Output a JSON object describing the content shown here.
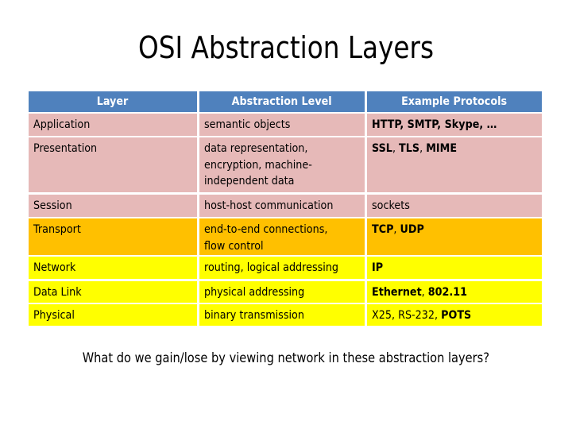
{
  "slide": {
    "title": "OSI Abstraction Layers",
    "question": "What do we gain/lose by viewing network in these abstraction layers?"
  },
  "colors": {
    "header": "#4f81bd",
    "upper_layers": "#e6b9b8",
    "transport": "#ffc000",
    "lower_layers": "#ffff00"
  },
  "table": {
    "headers": [
      "Layer",
      "Abstraction Level",
      "Example Protocols"
    ],
    "rows": [
      {
        "layer": "Application",
        "level_lines": [
          "semantic objects"
        ],
        "protocols": [
          {
            "t": "HTTP, SMTP, Skype, …",
            "b": true
          }
        ],
        "band": "pink"
      },
      {
        "layer": "Presentation",
        "level_lines": [
          "data representation,",
          "encryption, machine-",
          "independent data"
        ],
        "protocols": [
          {
            "t": "SSL",
            "b": true
          },
          {
            "t": ", ",
            "b": false
          },
          {
            "t": "TLS",
            "b": true
          },
          {
            "t": ", ",
            "b": false
          },
          {
            "t": "MIME",
            "b": true
          }
        ],
        "band": "pink"
      },
      {
        "layer": "Session",
        "level_lines": [
          "host-host communication"
        ],
        "protocols": [
          {
            "t": "sockets",
            "b": false
          }
        ],
        "band": "pink"
      },
      {
        "layer": "Transport",
        "level_lines": [
          "end-to-end connections,",
          "flow control"
        ],
        "protocols": [
          {
            "t": "TCP",
            "b": true
          },
          {
            "t": ", ",
            "b": false
          },
          {
            "t": "UDP",
            "b": true
          }
        ],
        "band": "orange"
      },
      {
        "layer": "Network",
        "level_lines": [
          "routing, logical addressing"
        ],
        "protocols": [
          {
            "t": "IP",
            "b": true
          }
        ],
        "band": "yellow"
      },
      {
        "layer": "Data Link",
        "level_lines": [
          "physical addressing"
        ],
        "protocols": [
          {
            "t": "Ethernet",
            "b": true
          },
          {
            "t": ", ",
            "b": false
          },
          {
            "t": "802.11",
            "b": true
          }
        ],
        "band": "yellow"
      },
      {
        "layer": "Physical",
        "level_lines": [
          "binary transmission"
        ],
        "protocols": [
          {
            "t": "X25, RS-232, ",
            "b": false
          },
          {
            "t": "POTS",
            "b": true
          }
        ],
        "band": "yellow"
      }
    ]
  }
}
